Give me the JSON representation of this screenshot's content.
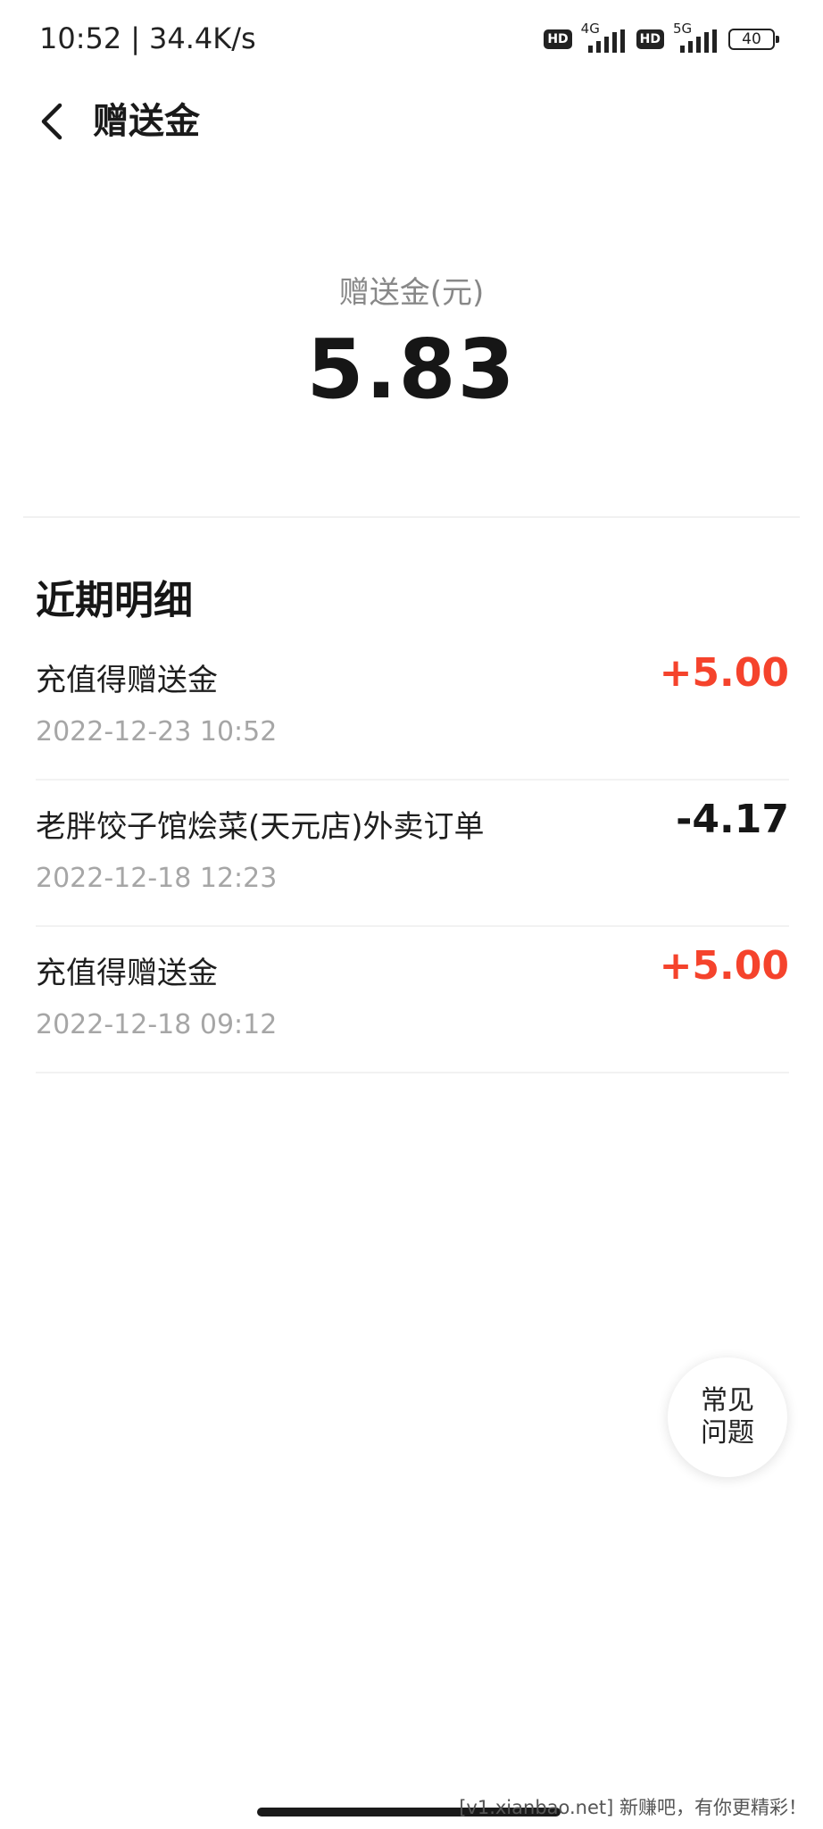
{
  "status_bar": {
    "time": "10:52",
    "separator": "|",
    "speed": "34.4K/s",
    "hd_label": "HD",
    "net1": "4G",
    "net2": "5G",
    "battery": "40"
  },
  "header": {
    "title": "赠送金"
  },
  "balance": {
    "label": "赠送金(元)",
    "amount": "5.83"
  },
  "details": {
    "title": "近期明细",
    "items": [
      {
        "title": "充值得赠送金",
        "time": "2022-12-23 10:52",
        "amount": "+5.00",
        "type": "credit"
      },
      {
        "title": "老胖饺子馆烩菜(天元店)外卖订单",
        "time": "2022-12-18 12:23",
        "amount": "-4.17",
        "type": "debit"
      },
      {
        "title": "充值得赠送金",
        "time": "2022-12-18 09:12",
        "amount": "+5.00",
        "type": "credit"
      }
    ]
  },
  "faq": {
    "line1": "常见",
    "line2": "问题"
  },
  "watermark": "[v1.xianbao.net] 新赚吧，有你更精彩！",
  "colors": {
    "credit": "#f5432c",
    "debit": "#161616"
  },
  "icons": {
    "back": "chevron-left-icon",
    "signal": "signal-bars-icon"
  }
}
